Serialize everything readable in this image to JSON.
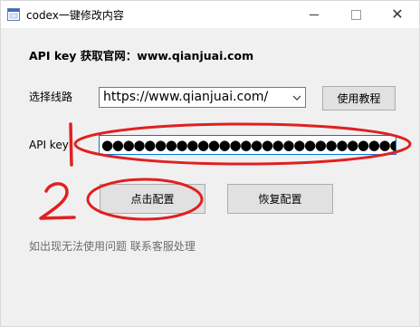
{
  "window": {
    "title": "codex一键修改内容"
  },
  "heading": "API key 获取官网：www.qianjuai.com",
  "route": {
    "label": "选择线路",
    "selected": "https://www.qianjuai.com/"
  },
  "buttons": {
    "tutorial": "使用教程",
    "apply": "点击配置",
    "restore": "恢复配置"
  },
  "api_key": {
    "label": "API key",
    "masked_value": "●●●●●●●●●●●●●●●●●●●●●●●●●●●●●●●●●●●●●"
  },
  "note": "如出现无法使用问题 联系客服处理",
  "annotations": {
    "step1": "1",
    "step2": "2",
    "color": "#e02020"
  }
}
